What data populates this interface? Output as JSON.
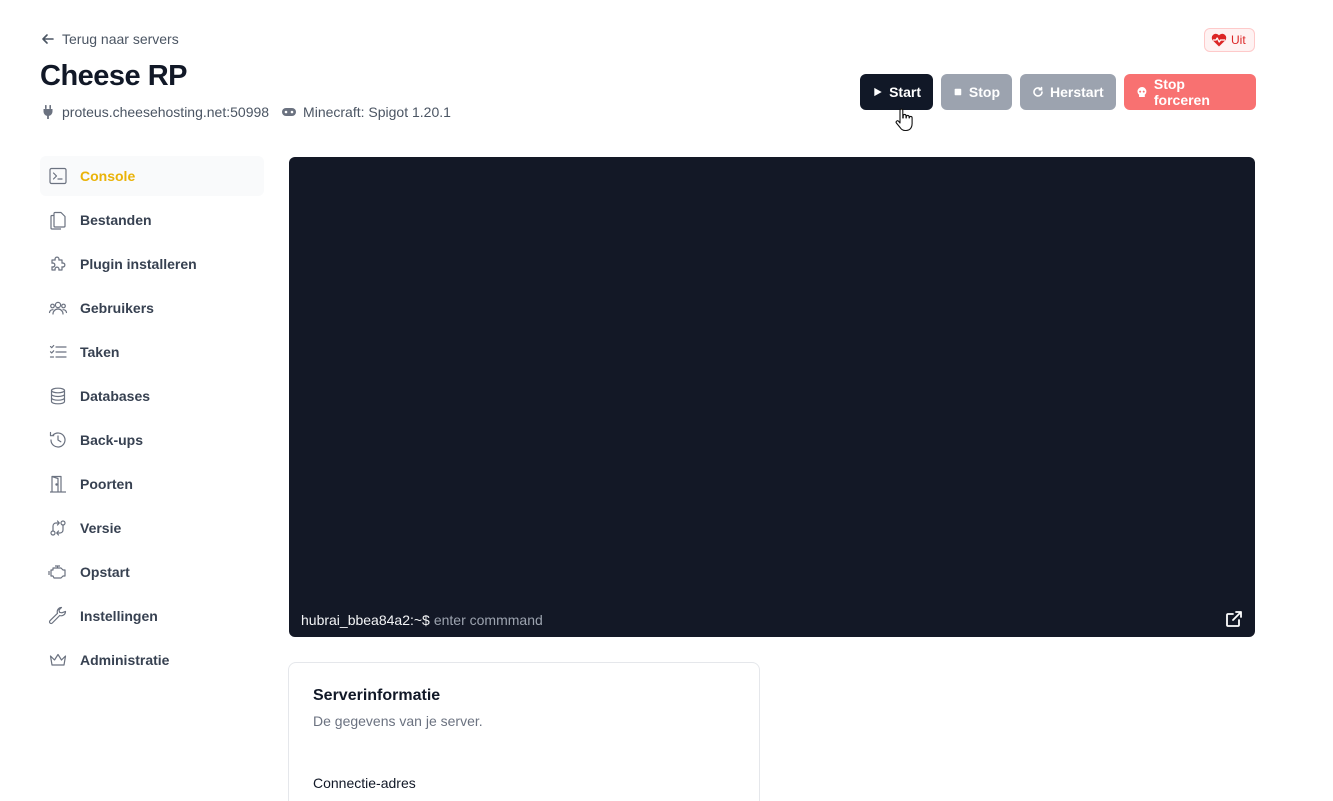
{
  "header": {
    "back_label": "Terug naar servers",
    "title": "Cheese RP",
    "address": "proteus.cheesehosting.net:50998",
    "game": "Minecraft: Spigot 1.20.1",
    "status": "Uit",
    "status_color": "#dc2626"
  },
  "actions": {
    "start": "Start",
    "stop": "Stop",
    "restart": "Herstart",
    "force_stop": "Stop forceren"
  },
  "sidebar": {
    "active_color": "#eab308",
    "items": [
      {
        "label": "Console",
        "icon": "terminal-icon"
      },
      {
        "label": "Bestanden",
        "icon": "files-icon"
      },
      {
        "label": "Plugin installeren",
        "icon": "puzzle-icon"
      },
      {
        "label": "Gebruikers",
        "icon": "users-icon"
      },
      {
        "label": "Taken",
        "icon": "checklist-icon"
      },
      {
        "label": "Databases",
        "icon": "database-icon"
      },
      {
        "label": "Back-ups",
        "icon": "history-icon"
      },
      {
        "label": "Poorten",
        "icon": "door-icon"
      },
      {
        "label": "Versie",
        "icon": "version-icon"
      },
      {
        "label": "Opstart",
        "icon": "engine-icon"
      },
      {
        "label": "Instellingen",
        "icon": "wrench-icon"
      },
      {
        "label": "Administratie",
        "icon": "crown-icon"
      }
    ]
  },
  "console": {
    "prompt": "hubrai_bbea84a2:~$",
    "placeholder": "enter commmand",
    "background": "#131826"
  },
  "info": {
    "title": "Serverinformatie",
    "subtitle": "De gegevens van je server.",
    "connection_label": "Connectie-adres"
  }
}
